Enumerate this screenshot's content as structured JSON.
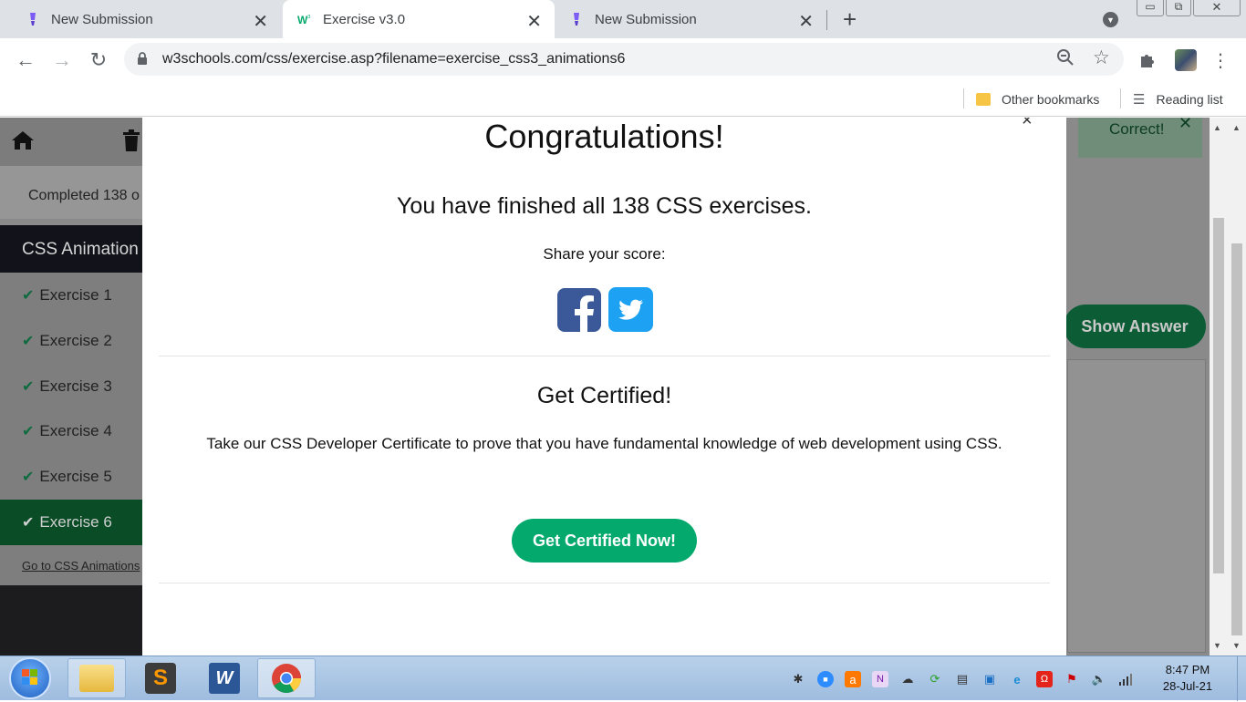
{
  "browser": {
    "tabs": [
      {
        "title": "New Submission",
        "icon": "brush-icon"
      },
      {
        "title": "Exercise v3.0",
        "icon": "w3schools-icon"
      },
      {
        "title": "New Submission",
        "icon": "brush-icon"
      }
    ],
    "url": "w3schools.com/css/exercise.asp?filename=exercise_css3_animations6",
    "bookmarks": {
      "other": "Other bookmarks",
      "reading": "Reading list"
    }
  },
  "page": {
    "completed": "Completed 138 o",
    "sidebar_title": "CSS Animation",
    "exercises": [
      "Exercise 1",
      "Exercise 2",
      "Exercise 3",
      "Exercise 4",
      "Exercise 5",
      "Exercise 6"
    ],
    "active_exercise": 6,
    "back_link": "Go to CSS Animations",
    "correct": "Correct!",
    "show_answer": "Show Answer"
  },
  "modal": {
    "title": "Congratulations!",
    "finished": "You have finished all 138 CSS exercises.",
    "share": "Share your score:",
    "cert_title": "Get Certified!",
    "cert_text": "Take our CSS Developer Certificate to prove that you have fundamental knowledge of web development using CSS.",
    "cert_button": "Get Certified Now!",
    "close": "×"
  },
  "taskbar": {
    "time": "8:47 PM",
    "date": "28-Jul-21"
  },
  "colors": {
    "w3_green": "#04aa6d",
    "facebook": "#3b5998",
    "twitter": "#1da1f2"
  }
}
